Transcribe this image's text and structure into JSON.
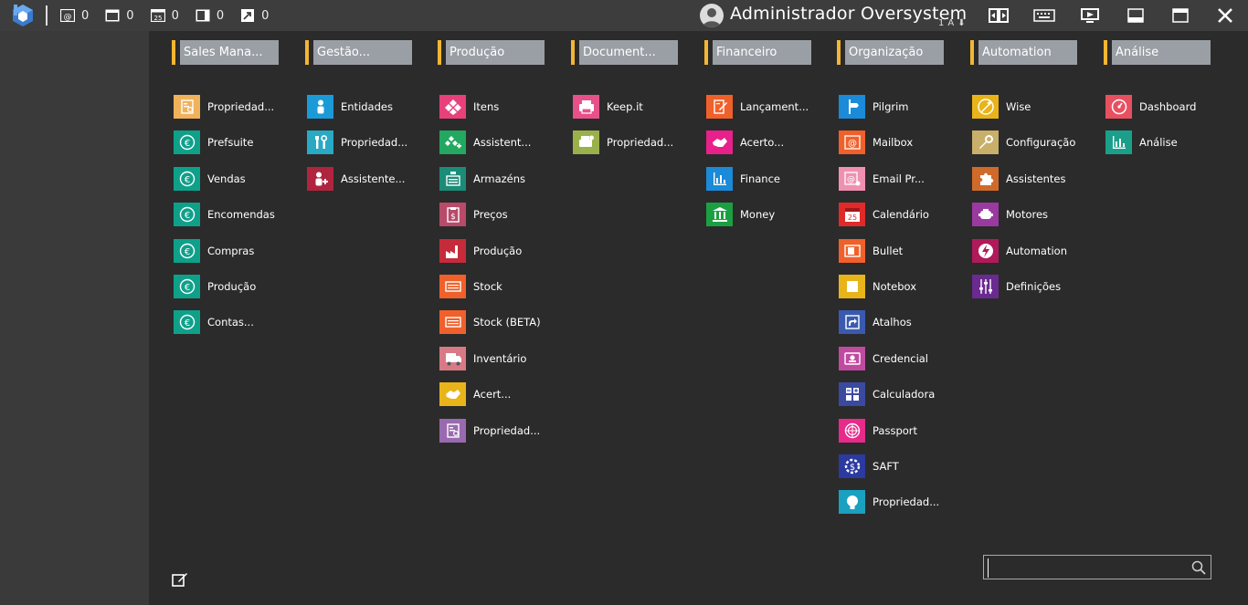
{
  "topbar": {
    "counters": [
      {
        "icon": "at-icon",
        "value": "0"
      },
      {
        "icon": "window-icon",
        "value": "0"
      },
      {
        "icon": "calendar-icon",
        "value": "0"
      },
      {
        "icon": "panel-icon",
        "value": "0"
      },
      {
        "icon": "arrow-icon",
        "value": "0"
      }
    ],
    "user_name": "Administrador Oversystem",
    "user_sub": "1A"
  },
  "columns": [
    {
      "header": "Sales Mana...",
      "items": [
        {
          "label": "Propriedad...",
          "color": "#f0b25b",
          "icon": "properties-icon"
        },
        {
          "label": "Prefsuite",
          "color": "#0fa08a",
          "icon": "euro-icon"
        },
        {
          "label": "Vendas",
          "color": "#0fa08a",
          "icon": "euro-icon"
        },
        {
          "label": "Encomendas",
          "color": "#0fa08a",
          "icon": "euro-icon"
        },
        {
          "label": "Compras",
          "color": "#0fa08a",
          "icon": "euro-icon"
        },
        {
          "label": "Produção",
          "color": "#0fa08a",
          "icon": "euro-icon"
        },
        {
          "label": "Contas...",
          "color": "#0fa08a",
          "icon": "euro-icon"
        }
      ]
    },
    {
      "header": "Gestão...",
      "items": [
        {
          "label": "Entidades",
          "color": "#1b9ad8",
          "icon": "person-icon"
        },
        {
          "label": "Propriedad...",
          "color": "#2aa9c4",
          "icon": "tools-icon"
        },
        {
          "label": "Assistente...",
          "color": "#b0243f",
          "icon": "person-add-icon"
        }
      ]
    },
    {
      "header": "Produção",
      "items": [
        {
          "label": "Itens",
          "color": "#e8407a",
          "icon": "items-icon"
        },
        {
          "label": "Assistent...",
          "color": "#22a860",
          "icon": "items-add-icon"
        },
        {
          "label": "Armazéns",
          "color": "#1a8c78",
          "icon": "warehouse-icon"
        },
        {
          "label": "Preços",
          "color": "#b84a6a",
          "icon": "price-icon"
        },
        {
          "label": "Produção",
          "color": "#c52b3a",
          "icon": "factory-icon"
        },
        {
          "label": "Stock",
          "color": "#f0602a",
          "icon": "stock-icon"
        },
        {
          "label": "Stock (BETA)",
          "color": "#f0602a",
          "icon": "stock-icon"
        },
        {
          "label": "Inventário",
          "color": "#d87a86",
          "icon": "truck-icon"
        },
        {
          "label": "Acert...",
          "color": "#e8b41a",
          "icon": "handshake-icon"
        },
        {
          "label": "Propriedad...",
          "color": "#9a6ab0",
          "icon": "properties-icon"
        }
      ]
    },
    {
      "header": "Document...",
      "items": [
        {
          "label": "Keep.it",
          "color": "#e8508a",
          "icon": "printer-icon"
        },
        {
          "label": "Propriedad...",
          "color": "#9ab04a",
          "icon": "printer-settings-icon"
        }
      ]
    },
    {
      "header": "Financeiro",
      "items": [
        {
          "label": "Lançament...",
          "color": "#f0602a",
          "icon": "document-edit-icon"
        },
        {
          "label": "Acerto...",
          "color": "#e8208a",
          "icon": "handshake-icon"
        },
        {
          "label": "Finance",
          "color": "#1b8ad8",
          "icon": "bar-chart-icon"
        },
        {
          "label": "Money",
          "color": "#1aa040",
          "icon": "bank-icon"
        }
      ]
    },
    {
      "header": "Organização",
      "items": [
        {
          "label": "Pilgrim",
          "color": "#1b8ad8",
          "icon": "signpost-icon"
        },
        {
          "label": "Mailbox",
          "color": "#f0602a",
          "icon": "at-icon"
        },
        {
          "label": "Email Pr...",
          "color": "#f090b0",
          "icon": "email-settings-icon"
        },
        {
          "label": "Calendário",
          "color": "#e02a2a",
          "icon": "calendar-icon"
        },
        {
          "label": "Bullet",
          "color": "#f0602a",
          "icon": "bullet-icon"
        },
        {
          "label": "Notebox",
          "color": "#e8b41a",
          "icon": "note-icon"
        },
        {
          "label": "Atalhos",
          "color": "#3a5ab0",
          "icon": "shortcut-icon"
        },
        {
          "label": "Credencial",
          "color": "#c04aa0",
          "icon": "credential-icon"
        },
        {
          "label": "Calculadora",
          "color": "#3a4aa0",
          "icon": "calculator-icon"
        },
        {
          "label": "Passport",
          "color": "#e82a8a",
          "icon": "passport-icon"
        },
        {
          "label": "SAFT",
          "color": "#2a3aa0",
          "icon": "saft-icon"
        },
        {
          "label": "Propriedad...",
          "color": "#1aa0c0",
          "icon": "bulb-icon"
        }
      ]
    },
    {
      "header": "Automation",
      "items": [
        {
          "label": "Wise",
          "color": "#e8b41a",
          "icon": "wand-icon"
        },
        {
          "label": "Configuração",
          "color": "#c8b06a",
          "icon": "wrench-icon"
        },
        {
          "label": "Assistentes",
          "color": "#d06a2a",
          "icon": "puzzle-icon"
        },
        {
          "label": "Motores",
          "color": "#9a3aa0",
          "icon": "engine-icon"
        },
        {
          "label": "Automation",
          "color": "#b01a5a",
          "icon": "lightning-icon"
        },
        {
          "label": "Definições",
          "color": "#6a2a90",
          "icon": "sliders-icon"
        }
      ]
    },
    {
      "header": "Análise",
      "items": [
        {
          "label": "Dashboard",
          "color": "#e85060",
          "icon": "gauge-icon"
        },
        {
          "label": "Análise",
          "color": "#1aa08a",
          "icon": "bar-chart-icon"
        }
      ]
    }
  ],
  "search": {
    "placeholder": "",
    "value": ""
  }
}
